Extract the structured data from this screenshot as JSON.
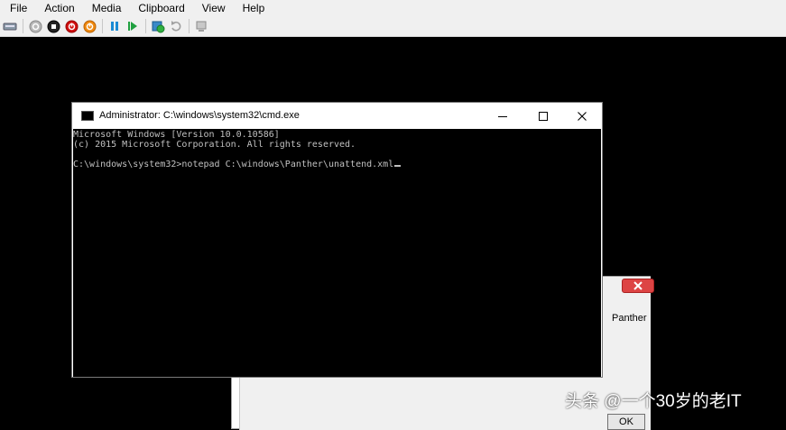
{
  "menu": [
    "File",
    "Action",
    "Media",
    "Clipboard",
    "View",
    "Help"
  ],
  "toolbar": {
    "icons": [
      "ctrl-alt-del-icon",
      "start-icon",
      "turn-off-icon",
      "shut-down-icon",
      "power-icon",
      "pause-icon",
      "resume-icon",
      "checkpoint-icon",
      "revert-icon",
      "enhanced-session-icon"
    ]
  },
  "cmd": {
    "title": "Administrator: C:\\windows\\system32\\cmd.exe",
    "lines": [
      "Microsoft Windows [Version 10.0.10586]",
      "(c) 2015 Microsoft Corporation. All rights reserved.",
      "",
      "C:\\windows\\system32>notepad C:\\windows\\Panther\\unattend.xml"
    ]
  },
  "background_dialog": {
    "text": "Panther",
    "ok_label": "OK"
  },
  "watermark": "头条 @一个30岁的老IT"
}
